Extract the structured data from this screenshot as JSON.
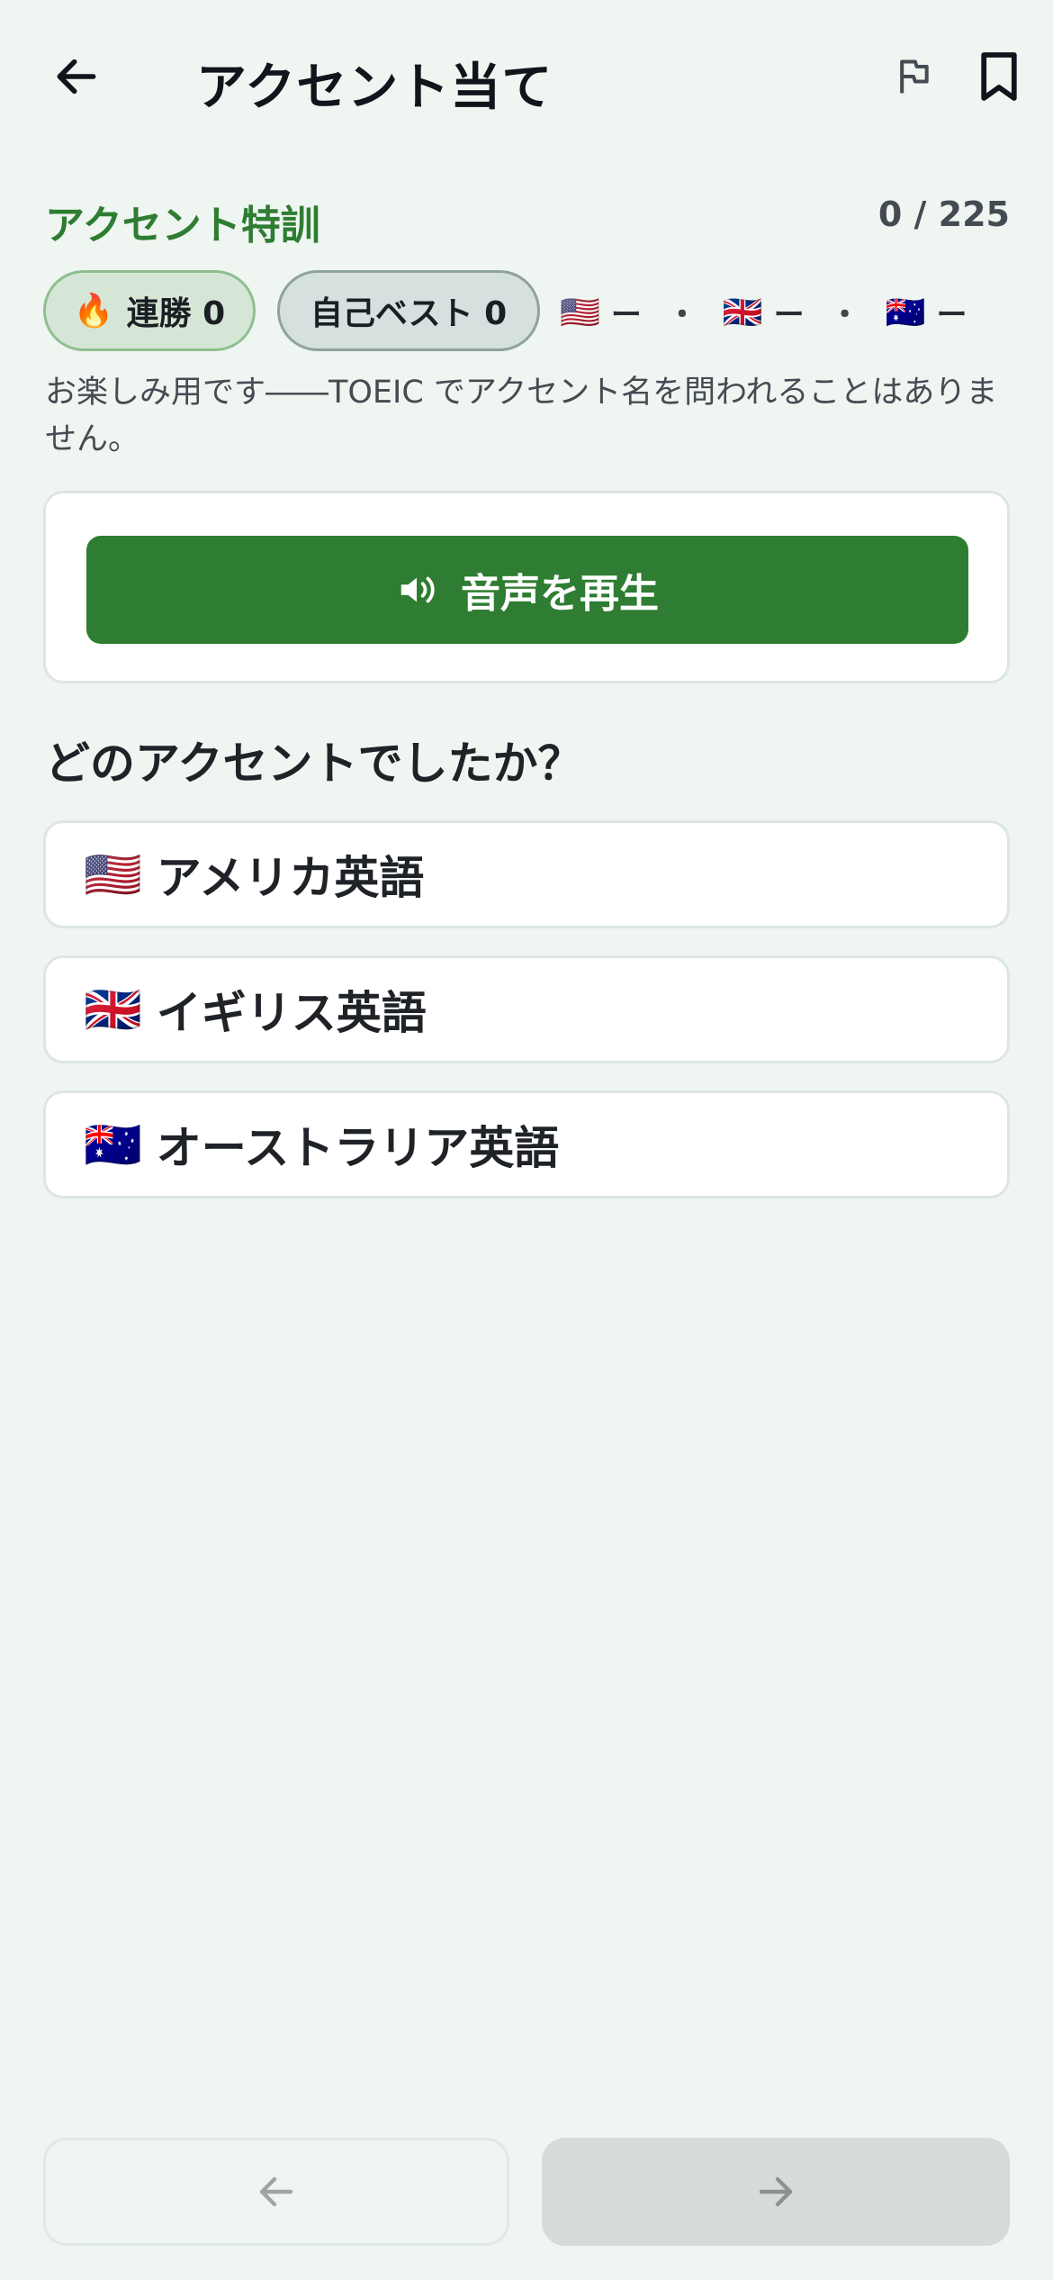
{
  "header": {
    "title": "アクセント当て",
    "icons": {
      "back": "arrow-left-icon",
      "report": "flag-icon",
      "save": "bookmark-icon"
    }
  },
  "section": {
    "title": "アクセント特訓",
    "progress": "0 / 225"
  },
  "chips": {
    "streak": {
      "emoji": "🔥",
      "label": "連勝 0"
    },
    "best": {
      "label": "自己ベスト 0"
    }
  },
  "accent_stats": [
    {
      "flag": "🇺🇸",
      "value": "ー"
    },
    {
      "separator": "・"
    },
    {
      "flag": "🇬🇧",
      "value": "ー"
    },
    {
      "separator": "・"
    },
    {
      "flag": "🇦🇺",
      "value": "ー"
    }
  ],
  "note": "お楽しみ用です――TOEIC でアクセント名を問われることはありません。",
  "play": {
    "label": "音声を再生",
    "icon": "speaker-icon"
  },
  "question": "どのアクセントでしたか？",
  "options": [
    {
      "flag": "🇺🇸",
      "label": "アメリカ英語"
    },
    {
      "flag": "🇬🇧",
      "label": "イギリス英語"
    },
    {
      "flag": "🇦🇺",
      "label": "オーストラリア英語"
    }
  ],
  "nav": {
    "prev_icon": "arrow-left-icon",
    "next_icon": "arrow-right-icon"
  },
  "colors": {
    "accent": "#2e7d32",
    "background": "#eff5f1",
    "card": "#ffffff"
  }
}
